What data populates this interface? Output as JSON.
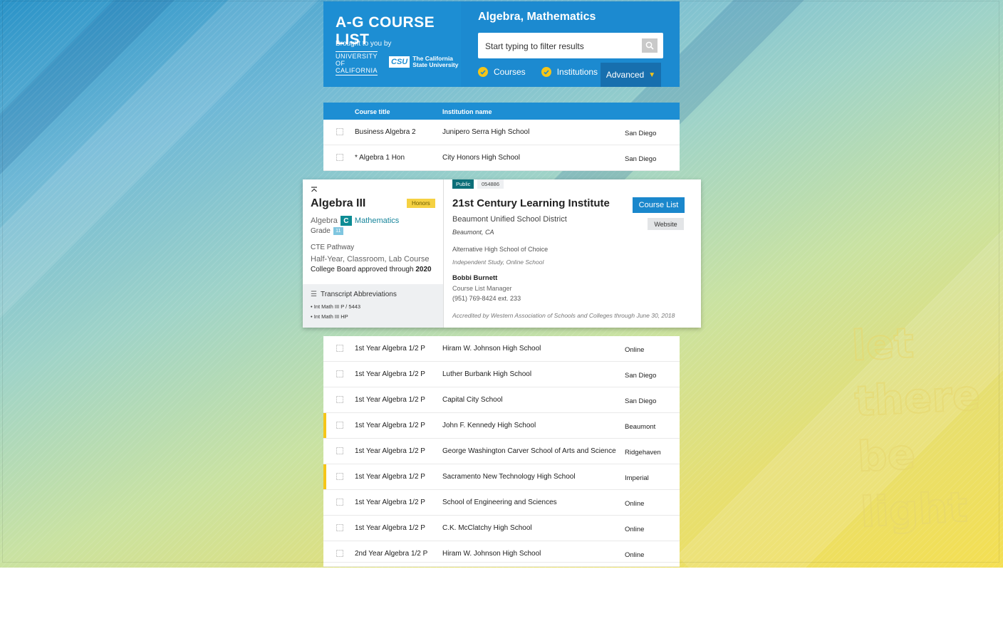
{
  "header": {
    "app_title": "A-G COURSE LIST",
    "brought_by": "Brought to you by",
    "uc_logo_lines": [
      "UNIVERSITY",
      "OF",
      "CALIFORNIA"
    ],
    "csu_logo_mark": "CSU",
    "csu_logo_lines": [
      "The California",
      "State University"
    ],
    "subject": "Algebra, Mathematics",
    "search_placeholder": "Start typing to filter results",
    "filters": [
      {
        "label": "Courses",
        "checked": true
      },
      {
        "label": "Institutions",
        "checked": true
      }
    ],
    "advanced_label": "Advanced",
    "accent_color": "#f5c518"
  },
  "table": {
    "headers": {
      "course": "Course title",
      "institution": "Institution name"
    },
    "top_rows": [
      {
        "course": "Business Algebra 2",
        "institution": "Junipero Serra High School",
        "city": "San Diego"
      },
      {
        "course": "* Algebra 1 Hon",
        "institution": "City Honors High School",
        "city": "San Diego"
      }
    ],
    "bottom_rows": [
      {
        "course": "1st Year Algebra 1/2 P",
        "institution": "Hiram W. Johnson High School",
        "city": "Online",
        "highlight": false
      },
      {
        "course": "1st Year Algebra 1/2 P",
        "institution": "Luther Burbank High School",
        "city": "San Diego",
        "highlight": false
      },
      {
        "course": "1st Year Algebra 1/2 P",
        "institution": "Capital City School",
        "city": "San Diego",
        "highlight": false
      },
      {
        "course": "1st Year Algebra 1/2 P",
        "institution": "John F. Kennedy High School",
        "city": "Beaumont",
        "highlight": true
      },
      {
        "course": "1st Year Algebra 1/2 P",
        "institution": "George Washington Carver School of Arts and Science",
        "city": "Ridgehaven",
        "highlight": false
      },
      {
        "course": "1st Year Algebra 1/2 P",
        "institution": "Sacramento New Technology High School",
        "city": "Imperial",
        "highlight": true
      },
      {
        "course": "1st Year Algebra 1/2 P",
        "institution": "School of Engineering and Sciences",
        "city": "Online",
        "highlight": false
      },
      {
        "course": "1st Year Algebra 1/2 P",
        "institution": "C.K. McClatchy High School",
        "city": "Online",
        "highlight": false
      },
      {
        "course": "2nd Year Algebra 1/2 P",
        "institution": "Hiram W. Johnson High School",
        "city": "Online",
        "highlight": false
      }
    ]
  },
  "detail": {
    "course": {
      "name": "Algebra III",
      "badge": "Honors",
      "subject_prefix": "Algebra",
      "subject_code": "C",
      "subject_name": "Mathematics",
      "grade_label": "Grade",
      "grade_value": "11",
      "cte": "CTE Pathway",
      "format": "Half-Year, Classroom, Lab Course",
      "approval_text": "College Board approved through",
      "approval_year": "2020",
      "transcript_heading": "Transcript Abbreviations",
      "transcript_items": [
        "• Int Math III P / 5443",
        "• Int Math III HP"
      ]
    },
    "institution": {
      "type_tag": "Public",
      "id": "054886",
      "name": "21st Century Learning Institute",
      "district": "Beaumont Unified School District",
      "city": "Beaumont, CA",
      "school_type": "Alternative High School of Choice",
      "study_modes": "Independent Study, Online School",
      "contact_name": "Bobbi Burnett",
      "contact_role": "Course List Manager",
      "contact_phone": "(951) 769-8424 ext. 233",
      "accreditation": "Accredited by Western Association of Schools and Colleges through June 30, 2018",
      "course_list_button": "Course List",
      "website_button": "Website"
    }
  },
  "watermark": {
    "lines": [
      "let",
      "there",
      "be",
      "light"
    ]
  }
}
